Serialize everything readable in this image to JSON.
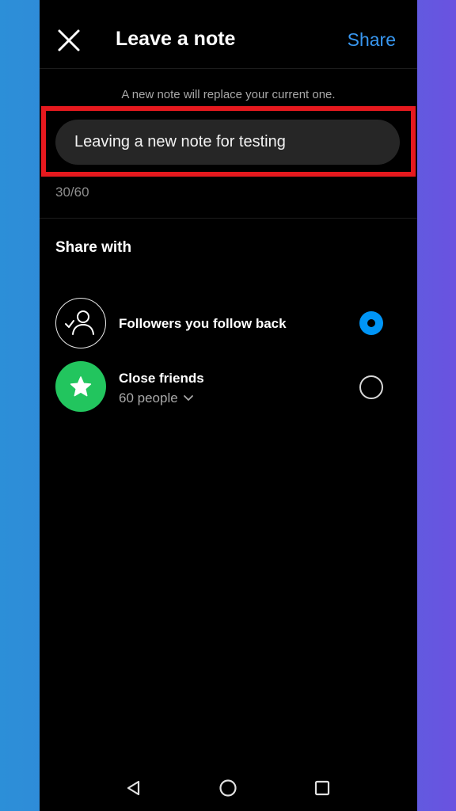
{
  "header": {
    "title": "Leave a note",
    "share_label": "Share",
    "close_icon": "close-icon"
  },
  "hint": "A new note will replace your current one.",
  "note": {
    "value": "Leaving a new note for testing",
    "counter": "30/60"
  },
  "share_with": {
    "title": "Share with",
    "options": [
      {
        "label": "Followers you follow back",
        "icon": "person-check-icon",
        "selected": true
      },
      {
        "label": "Close friends",
        "sublabel": "60 people",
        "icon": "star-icon",
        "selected": false
      }
    ]
  },
  "colors": {
    "accent": "#0095f6",
    "share_text": "#3897f0",
    "highlight": "#e6191e",
    "close_friends": "#22c55e",
    "background": "#000000"
  },
  "navbar": [
    "back-triangle-icon",
    "home-circle-icon",
    "recents-square-icon"
  ]
}
